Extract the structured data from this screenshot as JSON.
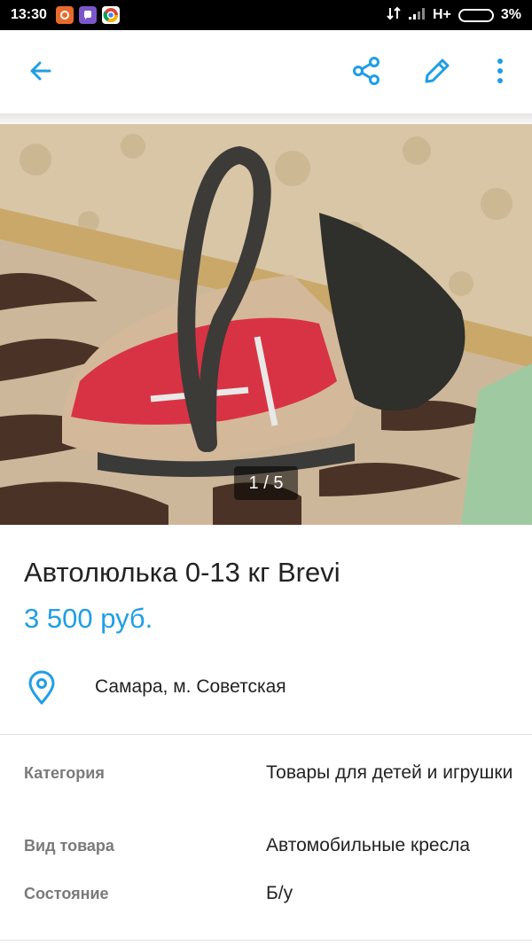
{
  "status_bar": {
    "time": "13:30",
    "network": "H+",
    "battery": "3%"
  },
  "toolbar": {
    "back_icon": "arrow-left-icon",
    "share_icon": "share-icon",
    "edit_icon": "pencil-icon",
    "menu_icon": "more-vertical-icon",
    "accent_color": "#1f9ee6"
  },
  "gallery": {
    "counter": "1 / 5"
  },
  "listing": {
    "title": "Автолюлька 0-13 кг Brevi",
    "price": "3 500 руб.",
    "location": "Самара, м. Советская"
  },
  "properties": [
    {
      "label": "Категория",
      "value": "Товары для детей и игрушки"
    },
    {
      "label": "Вид товара",
      "value": "Автомобильные кресла"
    },
    {
      "label": "Состояние",
      "value": "Б/у"
    }
  ]
}
